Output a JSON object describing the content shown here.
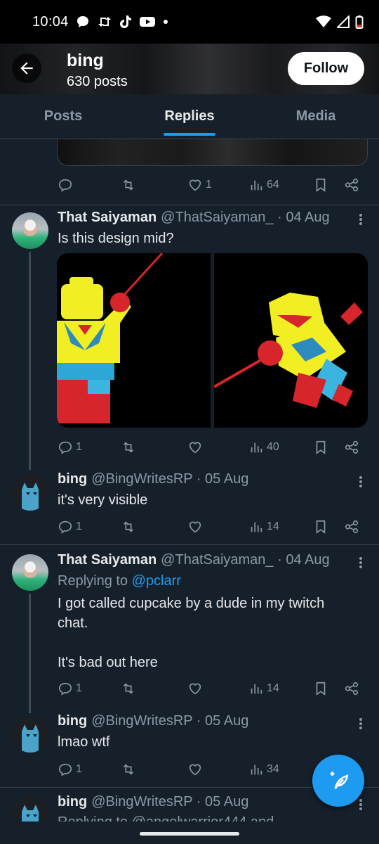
{
  "status_bar": {
    "time": "10:04"
  },
  "header": {
    "title": "bing",
    "subtitle": "630 posts",
    "follow_label": "Follow"
  },
  "tabs": [
    {
      "label": "Posts"
    },
    {
      "label": "Replies"
    },
    {
      "label": "Media"
    }
  ],
  "accent_color": "#1d9bf0",
  "tweets": [
    {
      "likes": "1",
      "views": "64"
    },
    {
      "name": "That Saiyaman",
      "handle": "@ThatSaiyaman_ · 04 Aug",
      "text": "Is this design mid?",
      "replies": "1",
      "views": "40"
    },
    {
      "name": "bing",
      "handle": "@BingWritesRP · 05 Aug",
      "text": "it's very visible",
      "replies": "1",
      "views": "14"
    },
    {
      "name": "That Saiyaman",
      "handle": "@ThatSaiyaman_ · 04 Aug",
      "reply_prefix": "Replying to ",
      "reply_to": "@pclarr",
      "text_line1": "I got called cupcake by a dude in my twitch",
      "text_line2": "chat.",
      "text_line3": "It's bad out here",
      "replies": "1",
      "views": "14"
    },
    {
      "name": "bing",
      "handle": "@BingWritesRP · 05 Aug",
      "text": "lmao wtf",
      "replies": "1",
      "views": "34"
    },
    {
      "name": "bing",
      "handle": "@BingWritesRP · 05 Aug",
      "reply_partial": "Replying to @angelwarrior444 and"
    }
  ]
}
